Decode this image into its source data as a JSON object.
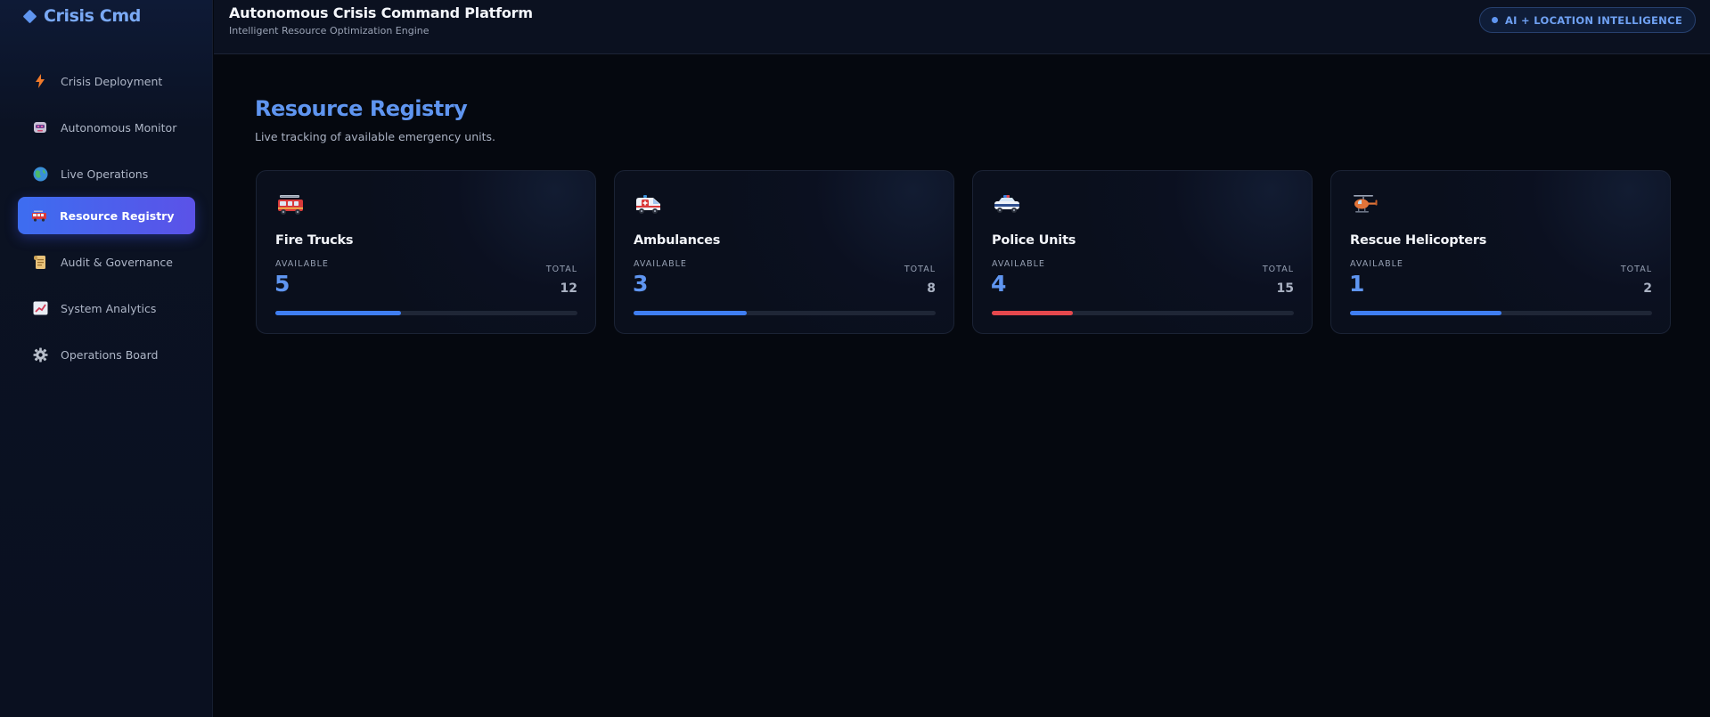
{
  "brand": {
    "name": "Crisis Cmd",
    "icon": "diamond-icon"
  },
  "header": {
    "title": "Autonomous Crisis Command Platform",
    "subtitle": "Intelligent Resource Optimization Engine",
    "badge": "AI + LOCATION INTELLIGENCE"
  },
  "sidebar": {
    "items": [
      {
        "label": "Crisis Deployment",
        "icon": "lightning-icon",
        "active": false
      },
      {
        "label": "Autonomous Monitor",
        "icon": "robot-icon",
        "active": false
      },
      {
        "label": "Live Operations",
        "icon": "globe-icon",
        "active": false
      },
      {
        "label": "Resource Registry",
        "icon": "fire-truck-icon",
        "active": true
      },
      {
        "label": "Audit & Governance",
        "icon": "scroll-icon",
        "active": false
      },
      {
        "label": "System Analytics",
        "icon": "chart-icon",
        "active": false
      },
      {
        "label": "Operations Board",
        "icon": "gear-icon",
        "active": false
      }
    ]
  },
  "main": {
    "title": "Resource Registry",
    "subtitle": "Live tracking of available emergency units.",
    "cards": [
      {
        "name": "Fire Trucks",
        "icon": "fire-truck-icon",
        "available": "5",
        "total": "12",
        "available_label": "AVAILABLE",
        "total_label": "TOTAL",
        "fill_fraction": 0.417,
        "bar_color": "#3f7ef2"
      },
      {
        "name": "Ambulances",
        "icon": "ambulance-icon",
        "available": "3",
        "total": "8",
        "available_label": "AVAILABLE",
        "total_label": "TOTAL",
        "fill_fraction": 0.375,
        "bar_color": "#3f7ef2"
      },
      {
        "name": "Police Units",
        "icon": "police-car-icon",
        "available": "4",
        "total": "15",
        "available_label": "AVAILABLE",
        "total_label": "TOTAL",
        "fill_fraction": 0.267,
        "bar_color": "#e5484d"
      },
      {
        "name": "Rescue Helicopters",
        "icon": "helicopter-icon",
        "available": "1",
        "total": "2",
        "available_label": "AVAILABLE",
        "total_label": "TOTAL",
        "fill_fraction": 0.5,
        "bar_color": "#3f7ef2"
      }
    ]
  },
  "colors": {
    "accent": "#5f95f0",
    "active_nav_start": "#3d6df0",
    "active_nav_end": "#5b52e8",
    "low_availability": "#e5484d"
  }
}
